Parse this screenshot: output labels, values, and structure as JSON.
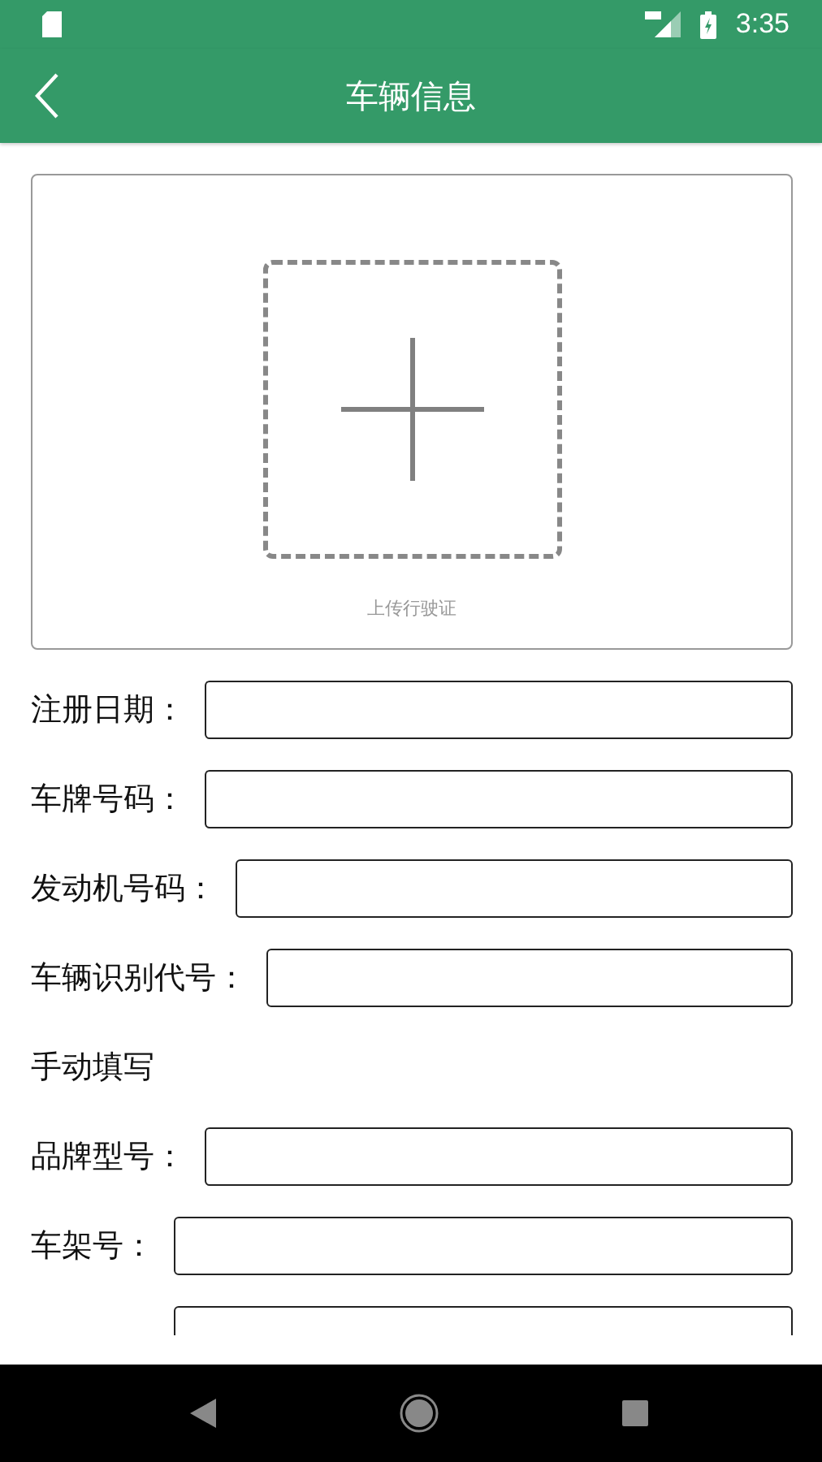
{
  "status_bar": {
    "time": "3:35"
  },
  "app_bar": {
    "title": "车辆信息"
  },
  "upload": {
    "caption": "上传行驶证"
  },
  "form": [
    {
      "kind": "field",
      "label": "注册日期："
    },
    {
      "kind": "field",
      "label": "车牌号码："
    },
    {
      "kind": "field",
      "label": "发动机号码："
    },
    {
      "kind": "field",
      "label": "车辆识别代号："
    },
    {
      "kind": "heading",
      "label": "手动填写"
    },
    {
      "kind": "field",
      "label": "品牌型号："
    },
    {
      "kind": "field",
      "label": "车架号："
    },
    {
      "kind": "field"
    }
  ]
}
